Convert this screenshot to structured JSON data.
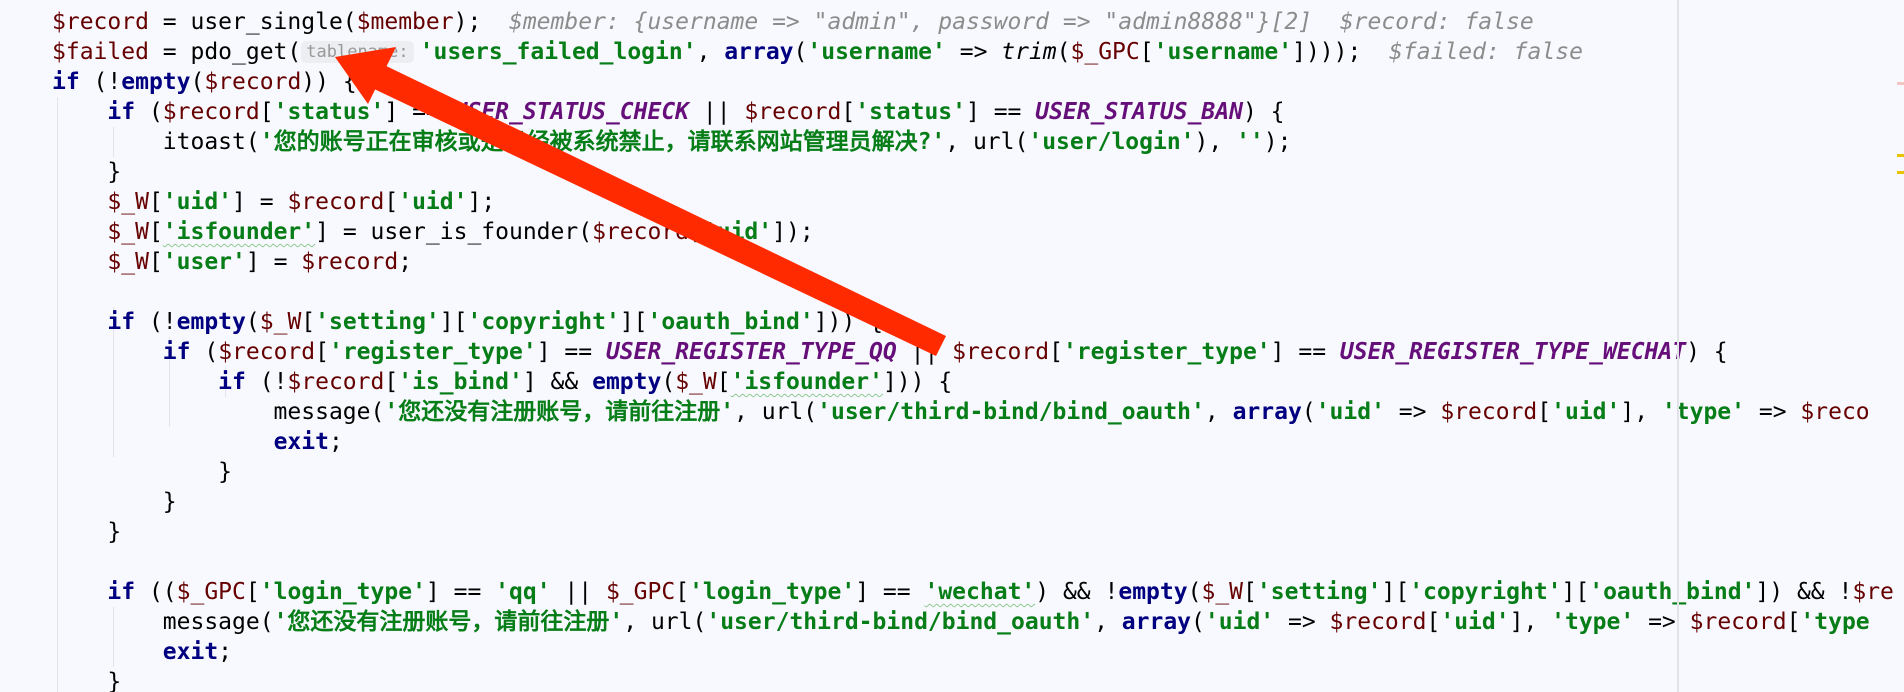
{
  "editor": {
    "language": "php",
    "colors": {
      "background": "#f7f9fe",
      "variable": "#660000",
      "string": "#067d17",
      "keyword": "#000080",
      "constant": "#660e7a",
      "hint": "#8c8c8c",
      "annotation_arrow": "#ff2a00",
      "error_marker": "#f4b8b8",
      "warning_marker": "#e6c200"
    },
    "lines": [
      [
        [
          "v",
          "$record"
        ],
        [
          "p",
          " = user_single("
        ],
        [
          "v",
          "$member"
        ],
        [
          "p",
          ");"
        ],
        [
          "h",
          "  $member: {username => \"admin\", password => \"admin8888\"}[2]  $record: false"
        ]
      ],
      [
        [
          "v",
          "$failed"
        ],
        [
          "p",
          " = pdo_get("
        ],
        [
          "t",
          "tablename:"
        ],
        [
          "s",
          "'users_failed_login'"
        ],
        [
          "p",
          ", "
        ],
        [
          "k",
          "array"
        ],
        [
          "p",
          "("
        ],
        [
          "s",
          "'username'"
        ],
        [
          "p",
          " => "
        ],
        [
          "f",
          "trim"
        ],
        [
          "p",
          "("
        ],
        [
          "v",
          "$_GPC"
        ],
        [
          "p",
          "["
        ],
        [
          "s",
          "'username'"
        ],
        [
          "p",
          "])));"
        ],
        [
          "h",
          "  $failed: false"
        ]
      ],
      [
        [
          "k",
          "if"
        ],
        [
          "p",
          " (!"
        ],
        [
          "k",
          "empty"
        ],
        [
          "p",
          "("
        ],
        [
          "v",
          "$record"
        ],
        [
          "p",
          ")) {"
        ]
      ],
      [
        [
          "p",
          "    "
        ],
        [
          "k",
          "if"
        ],
        [
          "p",
          " ("
        ],
        [
          "v",
          "$record"
        ],
        [
          "p",
          "["
        ],
        [
          "s",
          "'status'"
        ],
        [
          "p",
          "] == "
        ],
        [
          "c",
          "USER_STATUS_CHECK"
        ],
        [
          "p",
          " || "
        ],
        [
          "v",
          "$record"
        ],
        [
          "p",
          "["
        ],
        [
          "s",
          "'status'"
        ],
        [
          "p",
          "] == "
        ],
        [
          "c",
          "USER_STATUS_BAN"
        ],
        [
          "p",
          ") {"
        ]
      ],
      [
        [
          "p",
          "        itoast("
        ],
        [
          "s",
          "'您的账号正在审核或是已经被系统禁止，请联系网站管理员解决?'"
        ],
        [
          "p",
          ", url("
        ],
        [
          "s",
          "'user/login'"
        ],
        [
          "p",
          "), "
        ],
        [
          "s",
          "''"
        ],
        [
          "p",
          ");"
        ]
      ],
      [
        [
          "p",
          "    }"
        ]
      ],
      [
        [
          "p",
          "    "
        ],
        [
          "v",
          "$_W"
        ],
        [
          "p",
          "["
        ],
        [
          "s",
          "'uid'"
        ],
        [
          "p",
          "] = "
        ],
        [
          "v",
          "$record"
        ],
        [
          "p",
          "["
        ],
        [
          "s",
          "'uid'"
        ],
        [
          "p",
          "];"
        ]
      ],
      [
        [
          "p",
          "    "
        ],
        [
          "v",
          "$_W"
        ],
        [
          "p",
          "["
        ],
        [
          "w",
          "'isfounder'"
        ],
        [
          "p",
          "] = user_is_founder("
        ],
        [
          "v",
          "$record"
        ],
        [
          "p",
          "["
        ],
        [
          "s",
          "'uid'"
        ],
        [
          "p",
          "]);"
        ]
      ],
      [
        [
          "p",
          "    "
        ],
        [
          "v",
          "$_W"
        ],
        [
          "p",
          "["
        ],
        [
          "s",
          "'user'"
        ],
        [
          "p",
          "] = "
        ],
        [
          "v",
          "$record"
        ],
        [
          "p",
          ";"
        ]
      ],
      [],
      [
        [
          "p",
          "    "
        ],
        [
          "k",
          "if"
        ],
        [
          "p",
          " (!"
        ],
        [
          "k",
          "empty"
        ],
        [
          "p",
          "("
        ],
        [
          "v",
          "$_W"
        ],
        [
          "p",
          "["
        ],
        [
          "s",
          "'setting'"
        ],
        [
          "p",
          "]["
        ],
        [
          "s",
          "'copyright'"
        ],
        [
          "p",
          "]["
        ],
        [
          "s",
          "'oauth_bind'"
        ],
        [
          "p",
          "])) {"
        ]
      ],
      [
        [
          "p",
          "        "
        ],
        [
          "k",
          "if"
        ],
        [
          "p",
          " ("
        ],
        [
          "v",
          "$record"
        ],
        [
          "p",
          "["
        ],
        [
          "s",
          "'register_type'"
        ],
        [
          "p",
          "] == "
        ],
        [
          "c",
          "USER_REGISTER_TYPE_QQ"
        ],
        [
          "p",
          " || "
        ],
        [
          "v",
          "$record"
        ],
        [
          "p",
          "["
        ],
        [
          "s",
          "'register_type'"
        ],
        [
          "p",
          "] == "
        ],
        [
          "c",
          "USER_REGISTER_TYPE_WECHAT"
        ],
        [
          "p",
          ") {"
        ]
      ],
      [
        [
          "p",
          "            "
        ],
        [
          "k",
          "if"
        ],
        [
          "p",
          " (!"
        ],
        [
          "v",
          "$record"
        ],
        [
          "p",
          "["
        ],
        [
          "s",
          "'is_bind'"
        ],
        [
          "p",
          "] && "
        ],
        [
          "k",
          "empty"
        ],
        [
          "p",
          "("
        ],
        [
          "v",
          "$_W"
        ],
        [
          "p",
          "["
        ],
        [
          "w",
          "'isfounder'"
        ],
        [
          "p",
          "])) {"
        ]
      ],
      [
        [
          "p",
          "                message("
        ],
        [
          "s",
          "'您还没有注册账号，请前往注册'"
        ],
        [
          "p",
          ", url("
        ],
        [
          "s",
          "'user/third-bind/bind_oauth'"
        ],
        [
          "p",
          ", "
        ],
        [
          "k",
          "array"
        ],
        [
          "p",
          "("
        ],
        [
          "s",
          "'uid'"
        ],
        [
          "p",
          " => "
        ],
        [
          "v",
          "$record"
        ],
        [
          "p",
          "["
        ],
        [
          "s",
          "'uid'"
        ],
        [
          "p",
          "], "
        ],
        [
          "s",
          "'type'"
        ],
        [
          "p",
          " => "
        ],
        [
          "v",
          "$reco"
        ]
      ],
      [
        [
          "p",
          "                "
        ],
        [
          "k",
          "exit"
        ],
        [
          "p",
          ";"
        ]
      ],
      [
        [
          "p",
          "            }"
        ]
      ],
      [
        [
          "p",
          "        }"
        ]
      ],
      [
        [
          "p",
          "    }"
        ]
      ],
      [],
      [
        [
          "p",
          "    "
        ],
        [
          "k",
          "if"
        ],
        [
          "p",
          " (("
        ],
        [
          "v",
          "$_GPC"
        ],
        [
          "p",
          "["
        ],
        [
          "s",
          "'login_type'"
        ],
        [
          "p",
          "] == "
        ],
        [
          "s",
          "'qq'"
        ],
        [
          "p",
          " || "
        ],
        [
          "v",
          "$_GPC"
        ],
        [
          "p",
          "["
        ],
        [
          "s",
          "'login_type'"
        ],
        [
          "p",
          "] == "
        ],
        [
          "w",
          "'wechat'"
        ],
        [
          "p",
          ") && !"
        ],
        [
          "k",
          "empty"
        ],
        [
          "p",
          "("
        ],
        [
          "v",
          "$_W"
        ],
        [
          "p",
          "["
        ],
        [
          "s",
          "'setting'"
        ],
        [
          "p",
          "]["
        ],
        [
          "s",
          "'copyright'"
        ],
        [
          "p",
          "]["
        ],
        [
          "s",
          "'oauth_bind'"
        ],
        [
          "p",
          "]) && !"
        ],
        [
          "v",
          "$re"
        ]
      ],
      [
        [
          "p",
          "        message("
        ],
        [
          "s",
          "'您还没有注册账号，请前往注册'"
        ],
        [
          "p",
          ", url("
        ],
        [
          "s",
          "'user/third-bind/bind_oauth'"
        ],
        [
          "p",
          ", "
        ],
        [
          "k",
          "array"
        ],
        [
          "p",
          "("
        ],
        [
          "s",
          "'uid'"
        ],
        [
          "p",
          " => "
        ],
        [
          "v",
          "$record"
        ],
        [
          "p",
          "["
        ],
        [
          "s",
          "'uid'"
        ],
        [
          "p",
          "], "
        ],
        [
          "s",
          "'type'"
        ],
        [
          "p",
          " => "
        ],
        [
          "v",
          "$record"
        ],
        [
          "p",
          "["
        ],
        [
          "s",
          "'type"
        ]
      ],
      [
        [
          "p",
          "        "
        ],
        [
          "k",
          "exit"
        ],
        [
          "p",
          ";"
        ]
      ],
      [
        [
          "p",
          "    }"
        ]
      ]
    ]
  },
  "annotation": {
    "type": "red-arrow",
    "points_to": "tablename-parameter-hint"
  }
}
